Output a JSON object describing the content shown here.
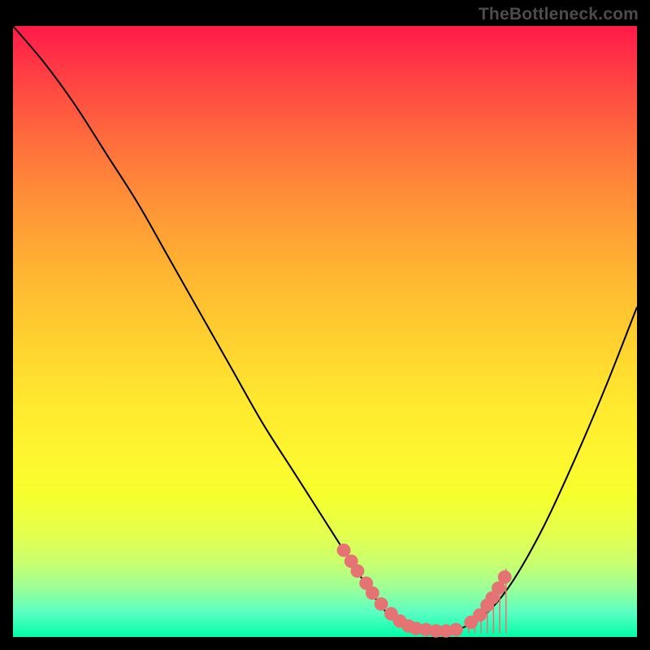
{
  "watermark": "TheBottleneck.com",
  "chart_data": {
    "type": "line",
    "title": "",
    "xlabel": "",
    "ylabel": "",
    "xlim": [
      0,
      100
    ],
    "ylim": [
      0,
      100
    ],
    "series": [
      {
        "name": "curve",
        "x": [
          0,
          5,
          10,
          15,
          20,
          25,
          30,
          35,
          40,
          45,
          50,
          55,
          57,
          59,
          61,
          63,
          65,
          68,
          72,
          76,
          80,
          85,
          90,
          95,
          100
        ],
        "y": [
          100,
          94,
          87,
          79,
          71,
          62,
          53,
          44,
          35,
          27,
          19,
          11,
          8,
          5,
          3,
          2,
          1.2,
          1,
          1.5,
          4,
          9,
          18,
          29,
          41,
          54
        ]
      }
    ],
    "markers": {
      "name": "scatter-markers",
      "color": "#e57373",
      "radius": 1.1,
      "x": [
        53.0,
        54.2,
        55.2,
        56.6,
        57.6,
        59.0,
        60.6,
        62.0,
        63.4,
        64.6,
        66.2,
        67.8,
        69.4,
        71.0,
        73.4,
        74.8,
        76.0,
        76.8,
        77.8,
        78.8
      ],
      "y": [
        14.2,
        12.4,
        10.8,
        8.8,
        7.2,
        5.4,
        3.8,
        2.6,
        1.8,
        1.4,
        1.2,
        1.0,
        1.0,
        1.2,
        2.4,
        3.6,
        5.2,
        6.4,
        8.0,
        9.8
      ]
    },
    "hatch_region": {
      "name": "hatch-lines",
      "color": "#e57373",
      "x_range": [
        73.0,
        79.0
      ],
      "y_top_at_x": [
        2.0,
        2.8,
        4.0,
        5.4,
        7.2,
        9.2,
        11.2
      ]
    },
    "gradient_stops": [
      {
        "offset": 0.0,
        "color": "#ff1a49"
      },
      {
        "offset": 0.5,
        "color": "#ffd22f"
      },
      {
        "offset": 0.8,
        "color": "#f6ff2e"
      },
      {
        "offset": 1.0,
        "color": "#00ffa8"
      }
    ]
  }
}
